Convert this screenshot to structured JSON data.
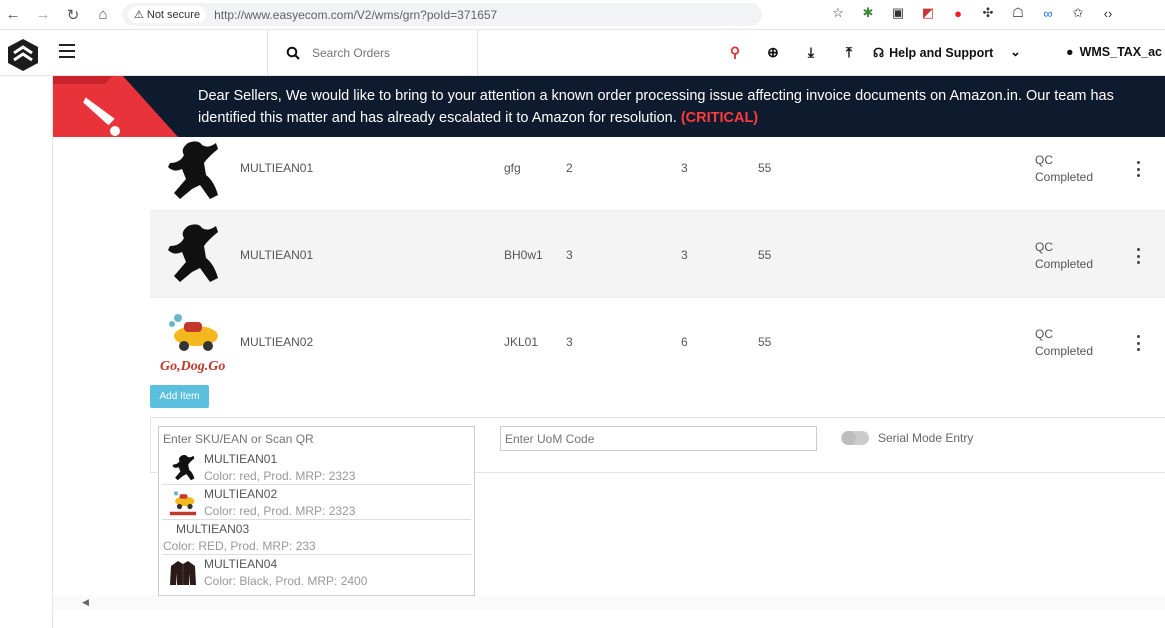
{
  "browser": {
    "security_label": "Not secure",
    "url": "http://www.easyecom.com/V2/wms/grn?poId=371657"
  },
  "header": {
    "search_placeholder": "Search Orders",
    "help_label": "Help and Support",
    "user_label": "WMS_TAX_ac"
  },
  "alert": {
    "message": "Dear Sellers, We would like to bring to your attention a known order processing issue affecting invoice documents on Amazon.in. Our team has identified this matter and has already escalated it to Amazon for resolution.",
    "tag": "(CRITICAL)"
  },
  "items": [
    {
      "sku": "MULTIEAN01",
      "code": "gfg",
      "col1": "2",
      "col2": "3",
      "col3": "55",
      "status_line1": "QC",
      "status_line2": "Completed",
      "image": "dancer-silhouette"
    },
    {
      "sku": "MULTIEAN01",
      "code": "BH0w1",
      "col1": "3",
      "col2": "3",
      "col3": "55",
      "status_line1": "QC",
      "status_line2": "Completed",
      "image": "dancer-silhouette"
    },
    {
      "sku": "MULTIEAN02",
      "code": "JKL01",
      "col1": "3",
      "col2": "6",
      "col3": "55",
      "status_line1": "QC",
      "status_line2": "Completed",
      "image": "go-dog-go"
    }
  ],
  "entry": {
    "add_item_label": "Add Item",
    "sku_placeholder": "Enter SKU/EAN or Scan QR",
    "uom_placeholder": "Enter UoM Code",
    "serial_label": "Serial Mode Entry"
  },
  "suggestions": [
    {
      "name": "MULTIEAN01",
      "meta": "Color: red, Prod. MRP: 2323",
      "image": "dancer-silhouette"
    },
    {
      "name": "MULTIEAN02",
      "meta": "Color: red, Prod. MRP: 2323",
      "image": "go-dog-go"
    },
    {
      "name": "MULTIEAN03",
      "meta": "Color: RED, Prod. MRP: 233",
      "image": ""
    },
    {
      "name": "MULTIEAN04",
      "meta": "Color: Black, Prod. MRP: 2400",
      "image": "black-jacket"
    }
  ],
  "colors": {
    "banner_bg": "#0e1a2e",
    "critical": "#ff3b3b",
    "add_button": "#5bc0de"
  }
}
